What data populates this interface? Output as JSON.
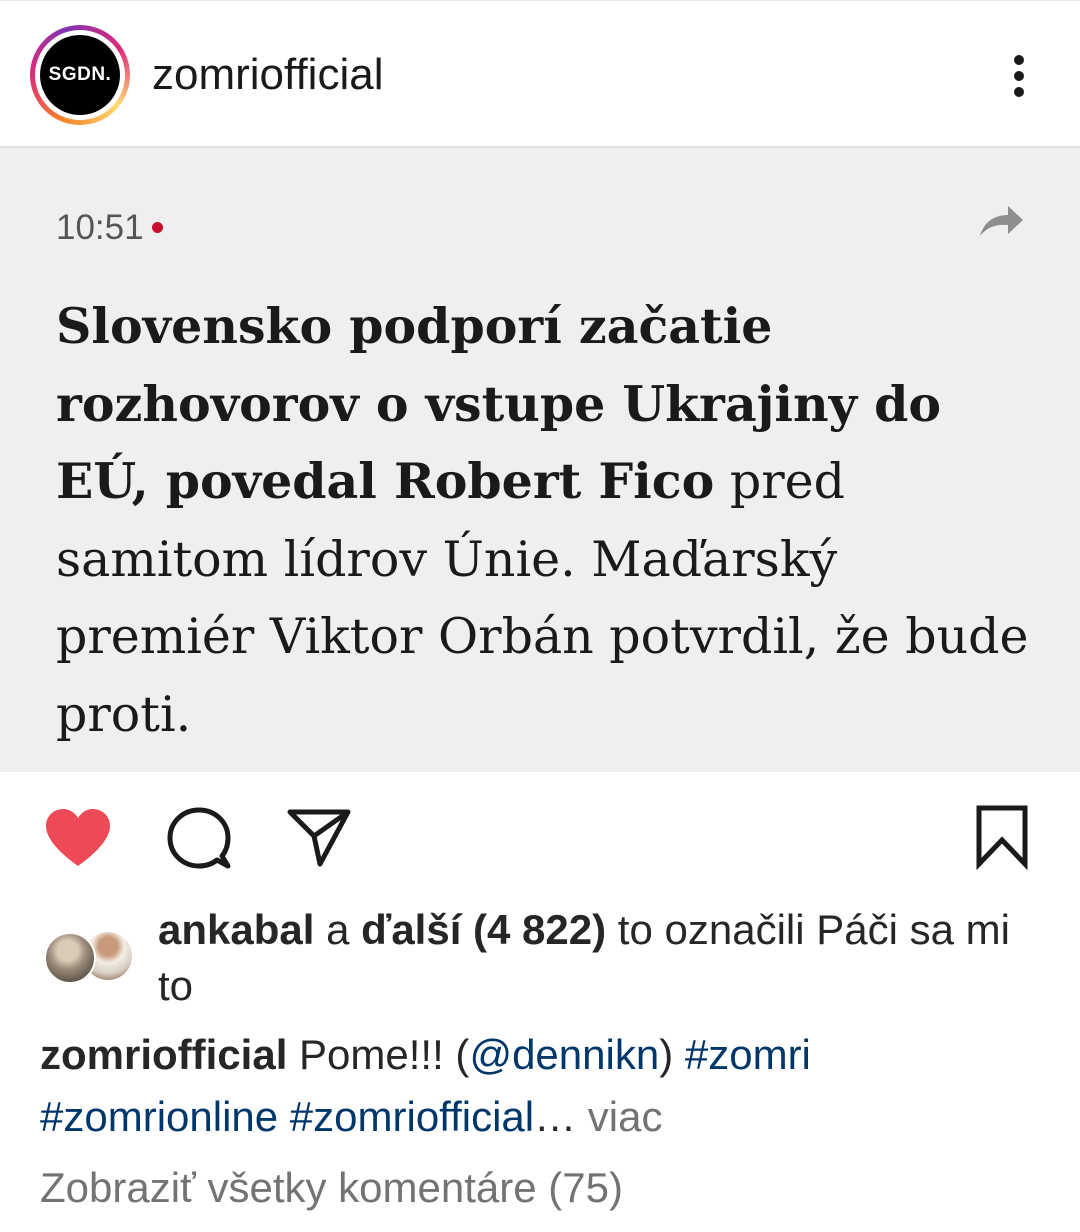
{
  "header": {
    "avatar_text": "SGDN.",
    "username": "zomriofficial"
  },
  "post": {
    "time": "10:51",
    "headline_bold": "Slovensko podporí začatie rozhovorov o vstupe Ukrajiny do EÚ, povedal Robert Fico",
    "headline_rest": " pred samitom lídrov Únie. Maďarský premiér Viktor Orbán potvrdil, že bude proti.",
    "accent_color": "#c8102e"
  },
  "actions": {
    "liked": true,
    "like_color": "#ed4956",
    "icons": [
      "heart-icon",
      "comment-icon",
      "share-icon",
      "bookmark-icon"
    ]
  },
  "likes": {
    "first_liker": "ankabal",
    "connector": " a ",
    "others": "ďalší (4 822)",
    "suffix": " to označili Páči sa mi to"
  },
  "caption": {
    "username": "zomriofficial",
    "text": " Pome!!! (",
    "mention": "@dennikn",
    "close": ") ",
    "hashtag1": "#zomri",
    "hashtag2": "#zomrionline",
    "hashtag3": "#zomriofficial",
    "ellipsis": "…",
    "more": " viac"
  },
  "comments": {
    "view_all": "Zobraziť všetky komentáre (75)"
  }
}
